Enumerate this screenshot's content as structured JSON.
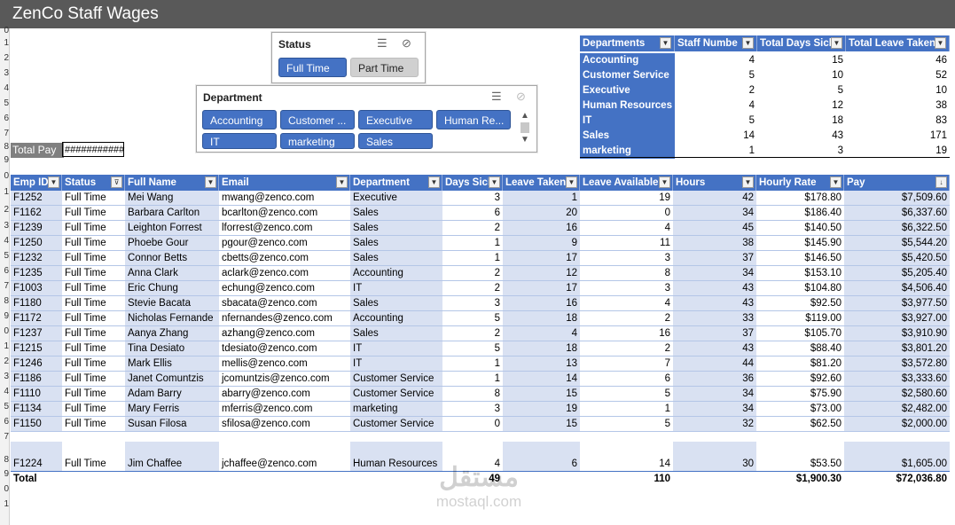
{
  "window": {
    "title": "ZenCo Staff Wages"
  },
  "row_numbers": [
    "0",
    "1",
    "2",
    "3",
    "4",
    "5",
    "6",
    "7",
    "8",
    "9",
    "0",
    "1",
    "2",
    "3",
    "4",
    "5",
    "6",
    "7",
    "8",
    "9",
    "0",
    "1",
    "2",
    "3",
    "4",
    "5",
    "6",
    "7",
    "8",
    "9",
    "0",
    "1"
  ],
  "total_pay": {
    "label": "Total Pay",
    "value": "###########"
  },
  "status_slicer": {
    "title": "Status",
    "items": [
      {
        "label": "Full Time",
        "selected": true
      },
      {
        "label": "Part Time",
        "selected": false
      }
    ]
  },
  "department_slicer": {
    "title": "Department",
    "items": [
      {
        "label": "Accounting",
        "selected": true
      },
      {
        "label": "Customer ...",
        "selected": true
      },
      {
        "label": "Executive",
        "selected": true
      },
      {
        "label": "Human Re...",
        "selected": true
      },
      {
        "label": "IT",
        "selected": true
      },
      {
        "label": "marketing",
        "selected": true
      },
      {
        "label": "Sales",
        "selected": true
      }
    ]
  },
  "pivot": {
    "headers": [
      "Departments",
      "Staff Numbe",
      "Total Days Sick",
      "Total Leave Taken"
    ],
    "rows": [
      [
        "Accounting",
        "4",
        "15",
        "46"
      ],
      [
        "Customer Service",
        "5",
        "10",
        "52"
      ],
      [
        "Executive",
        "2",
        "5",
        "10"
      ],
      [
        "Human Resources",
        "4",
        "12",
        "38"
      ],
      [
        "IT",
        "5",
        "18",
        "83"
      ],
      [
        "Sales",
        "14",
        "43",
        "171"
      ],
      [
        "marketing",
        "1",
        "3",
        "19"
      ]
    ]
  },
  "table": {
    "headers": [
      "Emp ID",
      "Status",
      "Full Name",
      "Email",
      "Department",
      "Days Sick",
      "Leave Taken",
      "Leave Available",
      "Hours",
      "Hourly Rate",
      "Pay"
    ],
    "rows": [
      [
        "F1252",
        "Full Time",
        "Mei Wang",
        "mwang@zenco.com",
        "Executive",
        "3",
        "1",
        "19",
        "42",
        "$178.80",
        "$7,509.60"
      ],
      [
        "F1162",
        "Full Time",
        "Barbara Carlton",
        "bcarlton@zenco.com",
        "Sales",
        "6",
        "20",
        "0",
        "34",
        "$186.40",
        "$6,337.60"
      ],
      [
        "F1239",
        "Full Time",
        "Leighton Forrest",
        "lforrest@zenco.com",
        "Sales",
        "2",
        "16",
        "4",
        "45",
        "$140.50",
        "$6,322.50"
      ],
      [
        "F1250",
        "Full Time",
        "Phoebe Gour",
        "pgour@zenco.com",
        "Sales",
        "1",
        "9",
        "11",
        "38",
        "$145.90",
        "$5,544.20"
      ],
      [
        "F1232",
        "Full Time",
        "Connor Betts",
        "cbetts@zenco.com",
        "Sales",
        "1",
        "17",
        "3",
        "37",
        "$146.50",
        "$5,420.50"
      ],
      [
        "F1235",
        "Full Time",
        "Anna Clark",
        "aclark@zenco.com",
        "Accounting",
        "2",
        "12",
        "8",
        "34",
        "$153.10",
        "$5,205.40"
      ],
      [
        "F1003",
        "Full Time",
        "Eric Chung",
        "echung@zenco.com",
        "IT",
        "2",
        "17",
        "3",
        "43",
        "$104.80",
        "$4,506.40"
      ],
      [
        "F1180",
        "Full Time",
        "Stevie Bacata",
        "sbacata@zenco.com",
        "Sales",
        "3",
        "16",
        "4",
        "43",
        "$92.50",
        "$3,977.50"
      ],
      [
        "F1172",
        "Full Time",
        "Nicholas Fernande",
        "nfernandes@zenco.com",
        "Accounting",
        "5",
        "18",
        "2",
        "33",
        "$119.00",
        "$3,927.00"
      ],
      [
        "F1237",
        "Full Time",
        "Aanya Zhang",
        "azhang@zenco.com",
        "Sales",
        "2",
        "4",
        "16",
        "37",
        "$105.70",
        "$3,910.90"
      ],
      [
        "F1215",
        "Full Time",
        "Tina Desiato",
        "tdesiato@zenco.com",
        "IT",
        "5",
        "18",
        "2",
        "43",
        "$88.40",
        "$3,801.20"
      ],
      [
        "F1246",
        "Full Time",
        "Mark Ellis",
        "mellis@zenco.com",
        "IT",
        "1",
        "13",
        "7",
        "44",
        "$81.20",
        "$3,572.80"
      ],
      [
        "F1186",
        "Full Time",
        "Janet Comuntzis",
        "jcomuntzis@zenco.com",
        "Customer Service",
        "1",
        "14",
        "6",
        "36",
        "$92.60",
        "$3,333.60"
      ],
      [
        "F1110",
        "Full Time",
        "Adam Barry",
        "abarry@zenco.com",
        "Customer Service",
        "8",
        "15",
        "5",
        "34",
        "$75.90",
        "$2,580.60"
      ],
      [
        "F1134",
        "Full Time",
        "Mary Ferris",
        "mferris@zenco.com",
        "marketing",
        "3",
        "19",
        "1",
        "34",
        "$73.00",
        "$2,482.00"
      ],
      [
        "F1150",
        "Full Time",
        "Susan Filosa",
        "sfilosa@zenco.com",
        "Customer Service",
        "0",
        "15",
        "5",
        "32",
        "$62.50",
        "$2,000.00"
      ],
      [
        "F1224",
        "Full Time",
        "Jim Chaffee",
        "jchaffee@zenco.com",
        "Human Resources",
        "4",
        "6",
        "14",
        "30",
        "$53.50",
        "$1,605.00"
      ]
    ],
    "total": {
      "label": "Total",
      "days_sick": "49",
      "leave_available": "110",
      "hourly_rate": "$1,900.30",
      "pay": "$72,036.80"
    }
  },
  "watermark": {
    "brand": "مستقل",
    "site": "mostaql.com"
  }
}
